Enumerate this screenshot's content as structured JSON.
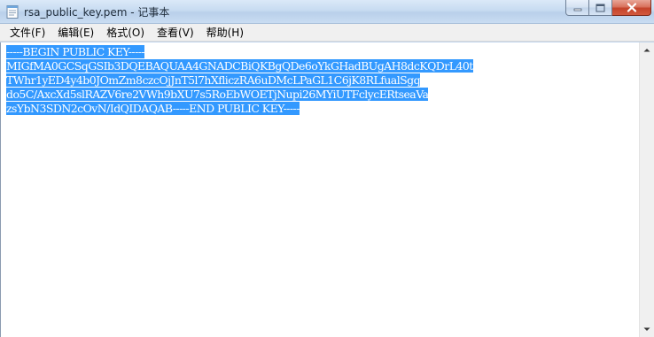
{
  "window": {
    "title": "rsa_public_key.pem - 记事本",
    "app_icon": "notepad-icon",
    "controls": {
      "minimize": "minimize-icon",
      "maximize": "maximize-icon",
      "close": "close-icon"
    }
  },
  "menu": {
    "items": [
      {
        "label": "文件(F)"
      },
      {
        "label": "编辑(E)"
      },
      {
        "label": "格式(O)"
      },
      {
        "label": "查看(V)"
      },
      {
        "label": "帮助(H)"
      }
    ]
  },
  "document": {
    "lines": [
      "-----BEGIN PUBLIC KEY-----",
      "MIGfMA0GCSqGSIb3DQEBAQUAA4GNADCBiQKBgQDe6oYkGHadBUgAH8dcKQDrL40t",
      "TWhr1yED4y4b0JOmZm8czcOjJnT5l7hXfliczRA6uDMcLPaGL1C6jK8RLfualSgq",
      "do5C/AxcXd5slRAZV6re2VWh9bXU7s5RoEbWOETjNupi26MYiUTFclycERtseaVa",
      "zsYbN3SDN2cOvN/IdQIDAQAB-----END PUBLIC KEY-----"
    ],
    "selection_color": "#3399ff"
  },
  "scrollbar": {
    "up_icon": "scroll-up-arrow-icon",
    "down_icon": "scroll-down-arrow-icon"
  }
}
